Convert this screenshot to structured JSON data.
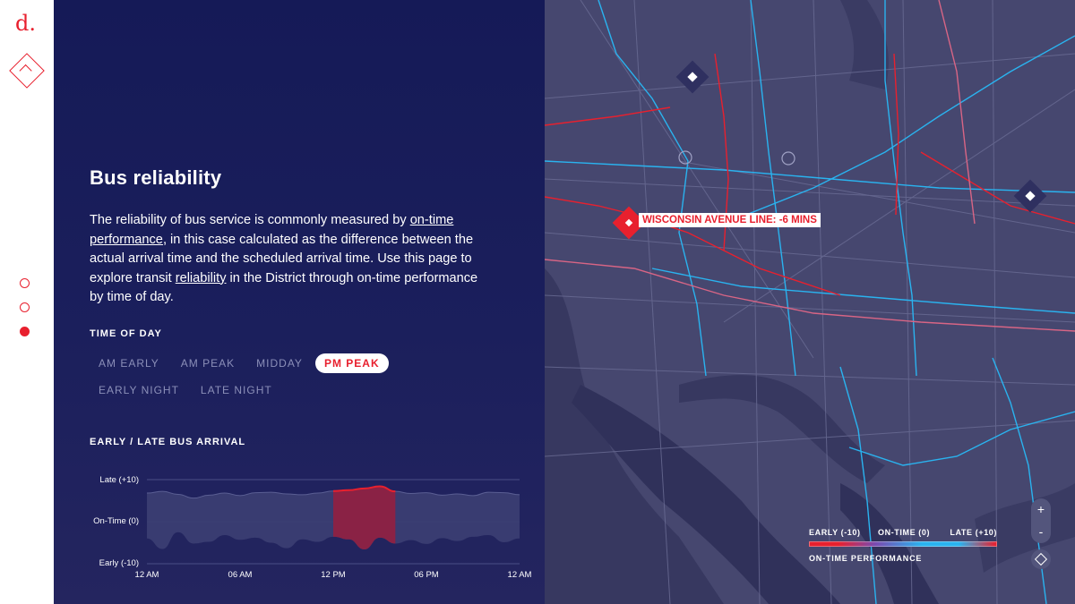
{
  "rail": {
    "logo": "d.",
    "pages": [
      "page-1",
      "page-2",
      "page-3"
    ]
  },
  "panel": {
    "title": "Bus reliability",
    "description": {
      "p1": "The reliability of bus service is commonly measured by ",
      "link1": "on-time performance",
      "p2": ", in this case calculated as the difference between the actual arrival time and the scheduled arrival time. Use this page to explore transit ",
      "link2": "reliability",
      "p3": " in the District through on-time performance by time of day."
    },
    "time_of_day_label": "TIME OF DAY",
    "time_of_day_options": [
      "AM EARLY",
      "AM PEAK",
      "MIDDAY",
      "PM PEAK",
      "EARLY NIGHT",
      "LATE NIGHT"
    ],
    "selected_time_of_day": "PM PEAK",
    "chart_label": "EARLY / LATE BUS ARRIVAL"
  },
  "chart_data": {
    "type": "area",
    "title": "EARLY / LATE BUS ARRIVAL",
    "xlabel": "",
    "ylabel": "",
    "x_ticks": [
      "12 AM",
      "06 AM",
      "12 PM",
      "06 PM",
      "12 AM"
    ],
    "y_ticks": [
      "Late (+10)",
      "On-Time (0)",
      "Early (-10)"
    ],
    "ylim": [
      -10,
      10
    ],
    "xlim": [
      0,
      24
    ],
    "highlight": {
      "label": "PM PEAK",
      "from": 12,
      "to": 16
    },
    "series": [
      {
        "x": [
          0,
          1,
          2,
          3,
          4,
          5,
          6,
          7,
          8,
          9,
          10,
          11,
          12,
          13,
          14,
          15,
          16,
          17,
          18,
          19,
          20,
          21,
          22,
          23,
          24
        ],
        "upper": [
          6.8,
          7.2,
          6.5,
          5.6,
          6.3,
          6.8,
          6.2,
          6.9,
          7.0,
          6.6,
          6.4,
          6.8,
          7.3,
          7.5,
          7.9,
          8.4,
          7.2,
          6.7,
          6.9,
          6.3,
          6.6,
          6.2,
          7.0,
          6.9,
          6.4
        ],
        "lower": [
          -4.0,
          -6.5,
          -2.5,
          -5.2,
          -4.8,
          -3.2,
          -4.3,
          -3.8,
          -5.0,
          -6.3,
          -4.2,
          -4.8,
          -3.6,
          -4.2,
          -6.6,
          -3.8,
          -5.2,
          -4.4,
          -5.3,
          -3.9,
          -4.6,
          -3.6,
          -3.2,
          -4.9,
          -4.0
        ]
      }
    ],
    "colors": {
      "band": "#3b3e72",
      "highlight": "#8a2245",
      "upper_line": "#e8202e"
    }
  },
  "map": {
    "callout_label": "WISCONSIN AVENUE LINE: -6 MINS",
    "legend": {
      "early": "EARLY (-10)",
      "ontime": "ON-TIME (0)",
      "late": "LATE (+10)",
      "caption": "ON-TIME PERFORMANCE"
    },
    "zoom_in": "+",
    "zoom_out": "-"
  },
  "colors": {
    "accent": "#e8202e",
    "panel": "#171c58",
    "map_bg": "#46476f",
    "on_time_blue": "#2ab3ef"
  }
}
